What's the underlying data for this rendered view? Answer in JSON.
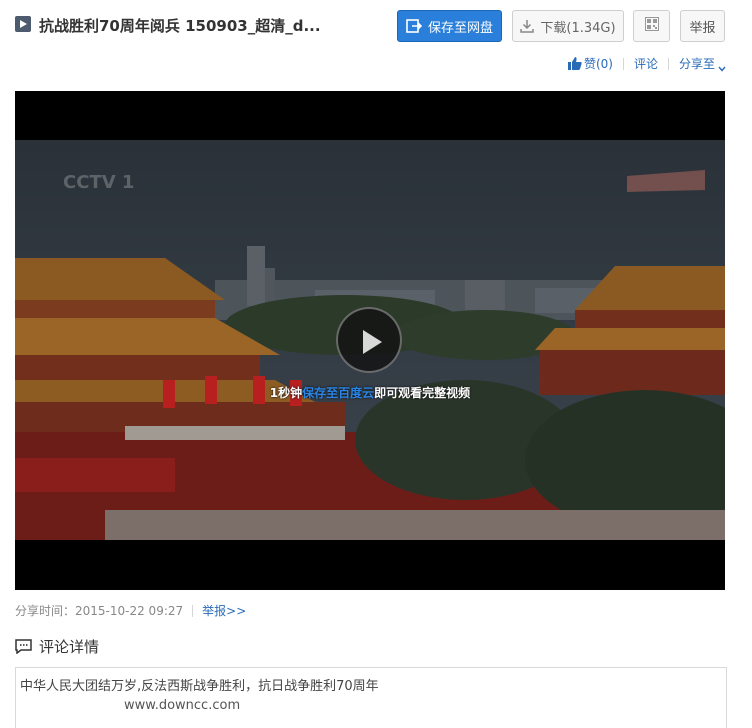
{
  "header": {
    "title": "抗战胜利70周年阅兵 150903_超清_d...",
    "save_label": "保存至网盘",
    "download_label": "下载(1.34G)",
    "report_label": "举报",
    "icons": {
      "file": "video-file-icon",
      "save": "save-to-cloud-icon",
      "download": "download-icon",
      "qr": "qr-code-icon"
    }
  },
  "actions": {
    "like_label": "赞(0)",
    "comment_label": "评论",
    "share_label": "分享至",
    "link_color": "#2a6bb8"
  },
  "player": {
    "play_icon": "play-icon",
    "promo_prefix": "1秒钟",
    "promo_highlight": "保存至百度云",
    "promo_suffix": "即可观看完整视频",
    "highlight_color": "#2a86e6"
  },
  "meta": {
    "share_time": "分享时间：2015-10-22 09:27",
    "report_link": "举报>>"
  },
  "comments": {
    "section_title": "评论详情",
    "line1": "中华人民大团结万岁,反法西斯战争胜利，抗日战争胜利70周年",
    "line2": "www.downcc.com"
  },
  "colors": {
    "primary_button": "#2a7fdb",
    "text": "#333333",
    "muted": "#888888"
  }
}
